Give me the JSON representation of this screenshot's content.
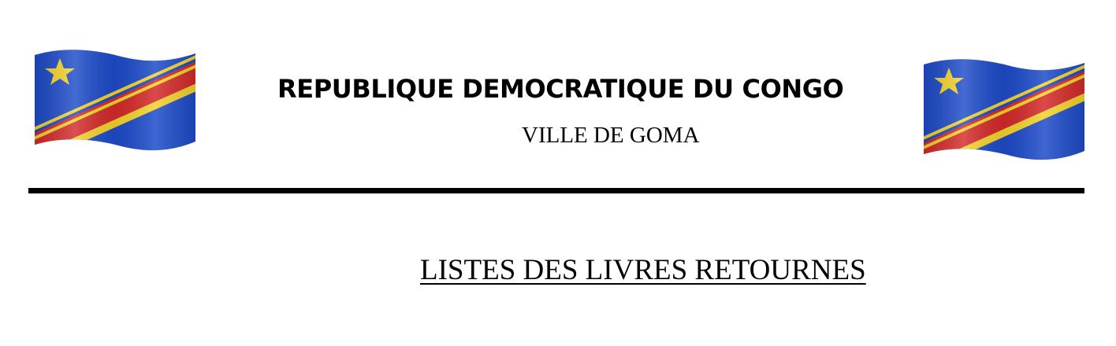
{
  "header": {
    "country": "REPUBLIQUE DEMOCRATIQUE DU CONGO",
    "city": "VILLE DE GOMA",
    "left_flag_icon": "drc-flag-icon",
    "right_flag_icon": "drc-flag-icon"
  },
  "document": {
    "title": "LISTES DES LIVRES RETOURNES"
  },
  "colors": {
    "flag_blue": "#1d4bc9",
    "flag_red": "#d42a2a",
    "flag_yellow": "#f4d32b",
    "text": "#000000"
  }
}
